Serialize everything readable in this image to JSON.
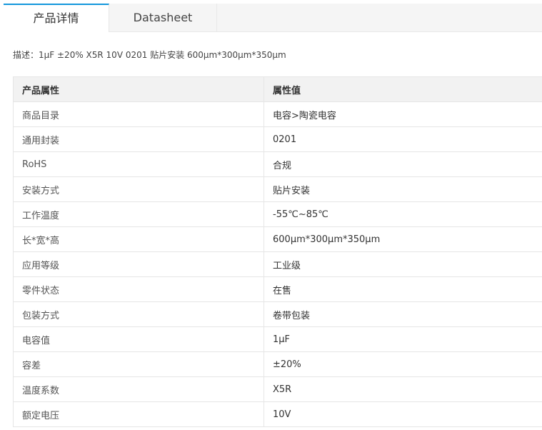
{
  "tabs": [
    {
      "label": "产品详情",
      "active": true
    },
    {
      "label": "Datasheet",
      "active": false
    }
  ],
  "description": {
    "label": "描述：",
    "value": "1μF ±20% X5R 10V 0201 贴片安装 600μm*300μm*350μm"
  },
  "table": {
    "headers": [
      "产品属性",
      "属性值"
    ],
    "rows": [
      [
        "商品目录",
        "电容>陶瓷电容"
      ],
      [
        "通用封装",
        "0201"
      ],
      [
        "RoHS",
        "合规"
      ],
      [
        "安装方式",
        "贴片安装"
      ],
      [
        "工作温度",
        "-55℃~85℃"
      ],
      [
        "长*宽*高",
        "600μm*300μm*350μm"
      ],
      [
        "应用等级",
        "工业级"
      ],
      [
        "零件状态",
        "在售"
      ],
      [
        "包装方式",
        "卷带包装"
      ],
      [
        "电容值",
        "1μF"
      ],
      [
        "容差",
        "±20%"
      ],
      [
        "温度系数",
        "X5R"
      ],
      [
        "额定电压",
        "10V"
      ]
    ]
  },
  "colors": {
    "accent": "#1296db",
    "header_bg": "#f2f2f2",
    "border": "#e6e6e6"
  }
}
